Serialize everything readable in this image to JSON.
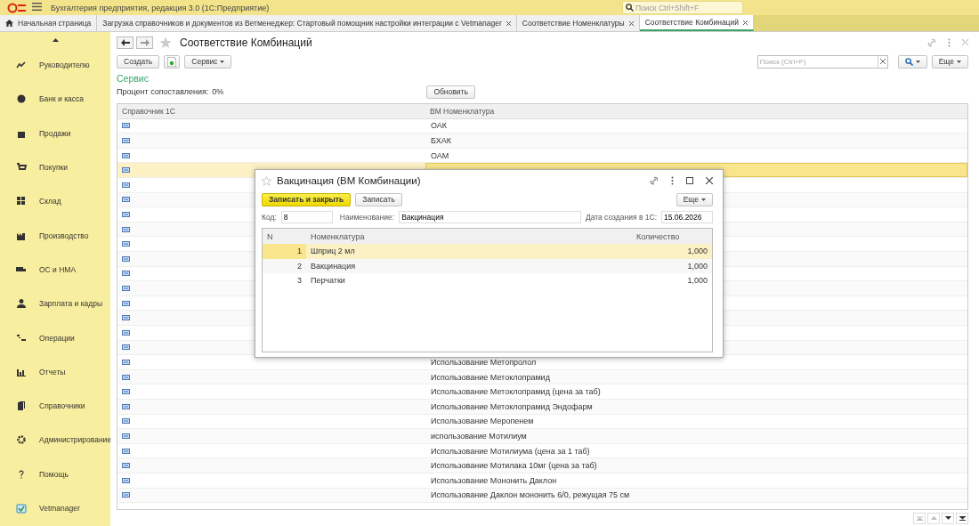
{
  "app_title": "Бухгалтерия предприятия, редакция 3.0  (1С:Предприятие)",
  "global_search": {
    "placeholder": "Поиск Ctrl+Shift+F"
  },
  "tabs": [
    {
      "label": "Начальная страница",
      "selected": false,
      "home": true
    },
    {
      "label": "Загрузка справочников и документов из Ветменеджер: Стартовый помощник настройки интеграции с Vetmanager",
      "selected": false
    },
    {
      "label": "Соответствие Номенклатуры",
      "selected": false
    },
    {
      "label": "Соответствие Комбинаций",
      "selected": true
    }
  ],
  "sidebar": {
    "items": [
      {
        "label": "Руководителю"
      },
      {
        "label": "Банк и касса"
      },
      {
        "label": "Продажи"
      },
      {
        "label": "Покупки"
      },
      {
        "label": "Склад"
      },
      {
        "label": "Производство"
      },
      {
        "label": "ОС и НМА"
      },
      {
        "label": "Зарплата и кадры"
      },
      {
        "label": "Операции"
      },
      {
        "label": "Отчеты"
      },
      {
        "label": "Справочники"
      },
      {
        "label": "Администрирование"
      },
      {
        "label": "Помощь"
      },
      {
        "label": "Vetmanager"
      }
    ]
  },
  "form": {
    "title": "Соответствие Комбинаций",
    "buttons": [
      "Создать",
      "Сервис"
    ],
    "search": {
      "placeholder": "Поиск (Ctrl+F)"
    },
    "more": "Еще",
    "group_title": "Сервис",
    "percent_label": "Процент сопоставления:",
    "percent_value": "0%",
    "refresh": "Обновить",
    "table": {
      "columns": [
        "Справочник 1С",
        "ВМ Номенклатура"
      ],
      "rows": [
        {
          "vm": "ОАК",
          "selected": false
        },
        {
          "vm": "БХАК",
          "selected": false
        },
        {
          "vm": "ОАМ",
          "selected": false
        },
        {
          "selected": true
        },
        {
          "selected": false
        },
        {
          "selected": false
        },
        {
          "selected": false
        },
        {
          "selected": false
        },
        {
          "selected": false
        },
        {
          "selected": false
        },
        {
          "selected": false
        },
        {
          "selected": false
        },
        {
          "selected": false
        },
        {
          "selected": false
        },
        {
          "selected": false
        },
        {
          "selected": false
        },
        {
          "vm": "Использование Метопролол",
          "selected": false
        },
        {
          "vm": "Использование Метоклопрамид",
          "selected": false
        },
        {
          "vm": "Использование Метоклопрамид (цена за таб)",
          "selected": false
        },
        {
          "vm": "Использование Метоклопрамид Эндофарм",
          "selected": false
        },
        {
          "vm": "Использование Меропенем",
          "selected": false
        },
        {
          "vm": "использование Мотилиум",
          "selected": false
        },
        {
          "vm": "Использование Мотилиума (цена за 1 таб)",
          "selected": false
        },
        {
          "vm": "Использование Мотилака 10мг (цена за таб)",
          "selected": false
        },
        {
          "vm": "Использование Мононить Даклон",
          "selected": false
        },
        {
          "vm": "Использование Даклон мононить 6/0, режущая 75 см",
          "selected": false
        }
      ]
    }
  },
  "dialog": {
    "title": "Вакцинация (ВМ Комбинации)",
    "save_close": "Записать и закрыть",
    "save": "Записать",
    "more": "Еще",
    "code_label": "Код:",
    "code": "8",
    "name_label": "Наименование:",
    "name": "Вакцинация",
    "date_label": "Дата создания в 1С:",
    "date": "15.06.2026",
    "table": {
      "columns": [
        "N",
        "Номенклатура",
        "Количество"
      ],
      "rows": [
        {
          "n": "1",
          "item": "Шприц 2 мл",
          "qty": "1,000",
          "selected": true
        },
        {
          "n": "2",
          "item": "Вакцинация",
          "qty": "1,000",
          "selected": false
        },
        {
          "n": "3",
          "item": "Перчатки",
          "qty": "1,000",
          "selected": false
        }
      ]
    }
  }
}
